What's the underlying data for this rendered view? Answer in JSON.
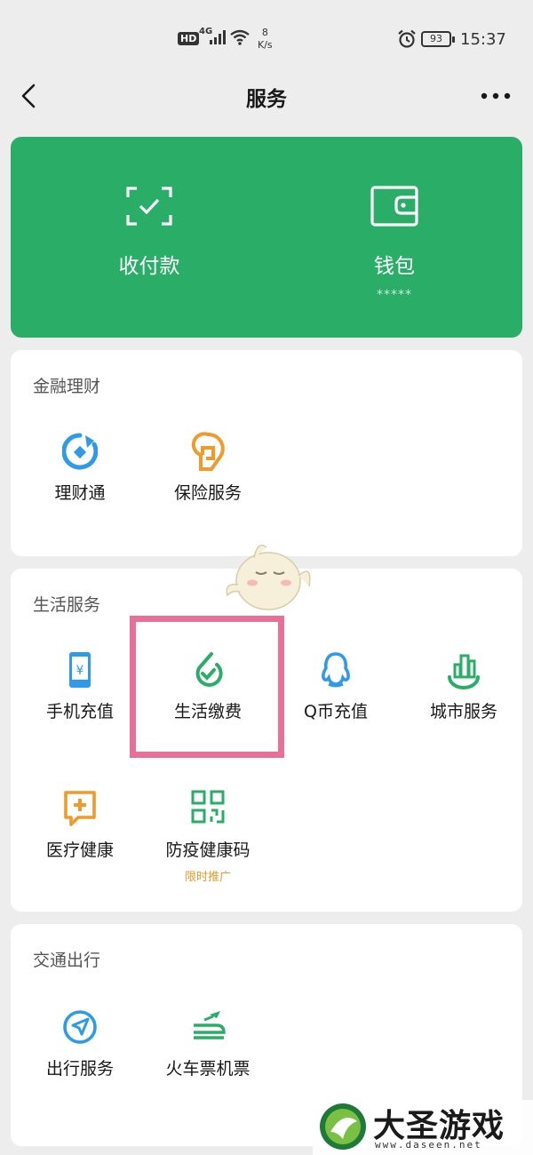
{
  "status_bar": {
    "hd": "HD",
    "network": "4G",
    "speed_value": "8",
    "speed_unit": "K/s",
    "battery": "93",
    "time": "15:37"
  },
  "nav": {
    "title": "服务",
    "back_icon": "chevron-left-icon",
    "more_icon": "more-icon"
  },
  "wallet_card": {
    "color": "#2aae67",
    "items": [
      {
        "label": "收付款",
        "icon": "scan-pay-icon"
      },
      {
        "label": "钱包",
        "icon": "wallet-icon",
        "sub": "*****"
      }
    ]
  },
  "sections": {
    "finance": {
      "title": "金融理财",
      "items": [
        {
          "label": "理财通",
          "icon": "wealth-icon"
        },
        {
          "label": "保险服务",
          "icon": "insurance-icon"
        }
      ]
    },
    "life": {
      "title": "生活服务",
      "items": [
        {
          "label": "手机充值",
          "icon": "phone-recharge-icon"
        },
        {
          "label": "生活缴费",
          "icon": "utility-payment-icon"
        },
        {
          "label": "Q币充值",
          "icon": "qq-coin-icon"
        },
        {
          "label": "城市服务",
          "icon": "city-service-icon"
        },
        {
          "label": "医疗健康",
          "icon": "medical-icon"
        },
        {
          "label": "防疫健康码",
          "icon": "health-code-icon",
          "sub": "限时推广"
        }
      ]
    },
    "travel": {
      "title": "交通出行",
      "items": [
        {
          "label": "出行服务",
          "icon": "navigation-icon"
        },
        {
          "label": "火车票机票",
          "icon": "train-ticket-icon"
        }
      ]
    }
  },
  "highlight_color": "#ea6f96",
  "watermark": {
    "title": "大圣游戏网",
    "url": "www.daseen.net"
  }
}
